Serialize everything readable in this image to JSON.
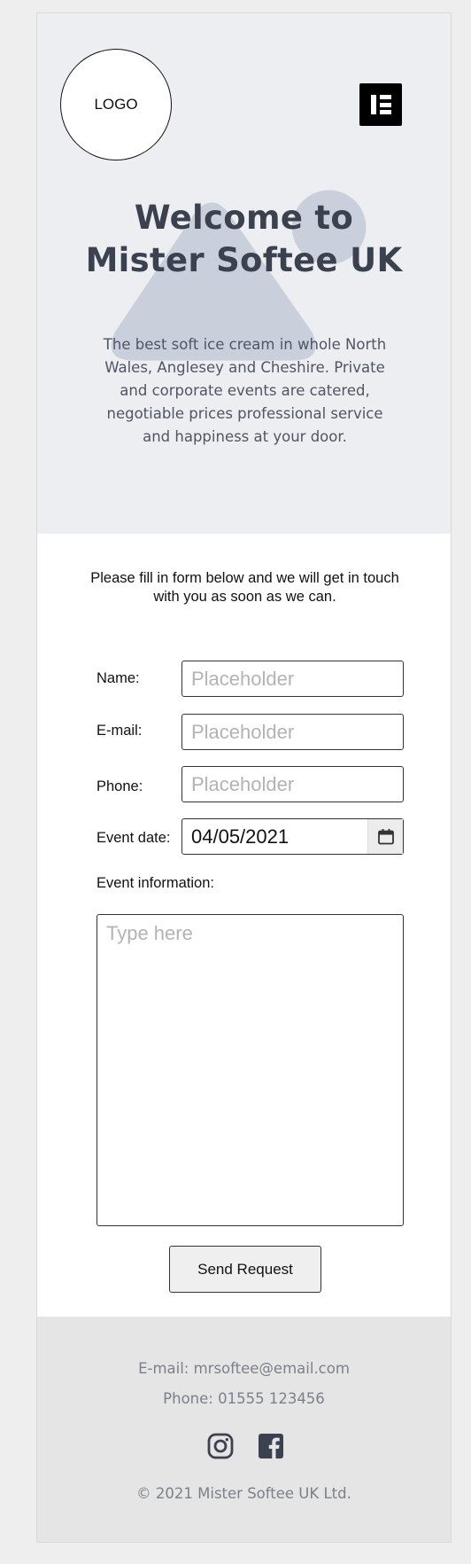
{
  "header": {
    "logo_text": "LOGO"
  },
  "hero": {
    "title_line1": "Welcome to",
    "title_line2": "Mister Softee UK",
    "description": "The best soft ice cream in whole North Wales, Anglesey and Cheshire. Private and corporate events are catered, negotiable prices professional service and happiness at your door."
  },
  "form": {
    "intro": "Please fill in form below and we will get in touch with you as soon as we can.",
    "name_label": "Name:",
    "name_placeholder": "Placeholder",
    "email_label": "E-mail:",
    "email_placeholder": "Placeholder",
    "phone_label": "Phone:",
    "phone_placeholder": "Placeholder",
    "date_label": "Event date:",
    "date_value": "04/05/2021",
    "info_label": "Event information:",
    "info_placeholder": "Type here",
    "submit_label": "Send Request"
  },
  "footer": {
    "email": "E-mail: mrsoftee@email.com",
    "phone": "Phone: 01555 123456",
    "copyright": "© 2021  Mister Softee UK Ltd.",
    "social_icons": [
      "instagram-icon",
      "facebook-icon"
    ]
  },
  "colors": {
    "hero_bg": "#eceef2",
    "title": "#3c4150",
    "footer_bg": "#e5e5e5",
    "footer_text": "#7b808b",
    "page_bg": "#eeeeee"
  }
}
